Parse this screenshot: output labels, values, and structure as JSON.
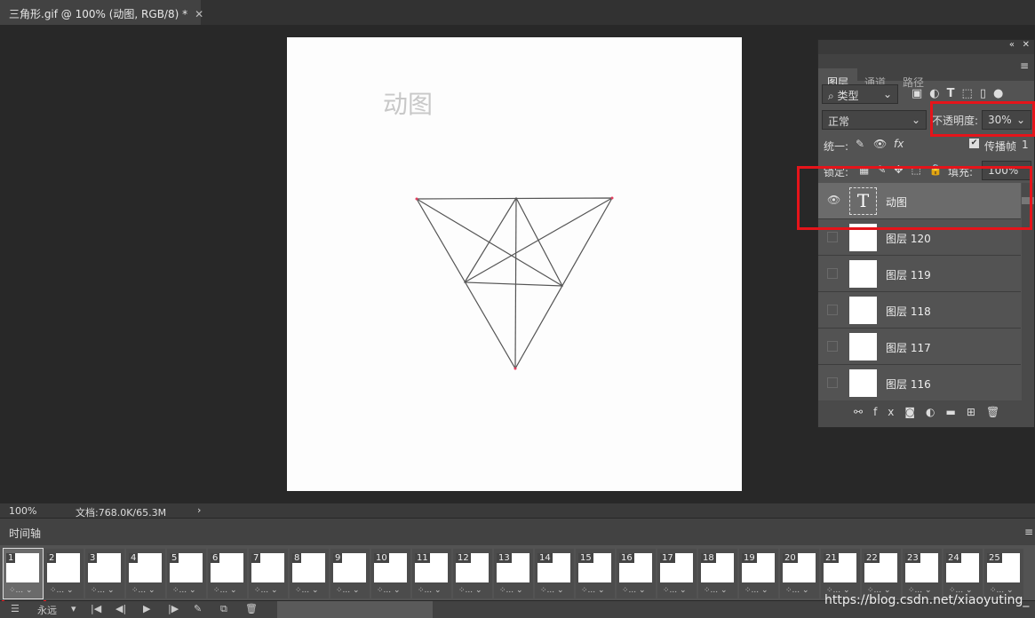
{
  "document": {
    "tab_title": "三角形.gif @ 100% (动图, RGB/8) *",
    "canvas_text": "动图"
  },
  "layers_panel": {
    "tabs": [
      "图层",
      "通道",
      "路径"
    ],
    "filter_kind": "类型",
    "blend_mode": "正常",
    "opacity_label": "不透明度:",
    "opacity_value": "30%",
    "unify_label": "统一:",
    "propagate_label": "传播帧",
    "propagate_value": "1",
    "propagate_checked": true,
    "lock_label": "锁定:",
    "fill_label": "填充:",
    "fill_value": "100%",
    "layers": [
      {
        "name": "动图",
        "type": "text",
        "visible": true,
        "selected": true
      },
      {
        "name": "图层 120",
        "visible": false
      },
      {
        "name": "图层 119",
        "visible": false
      },
      {
        "name": "图层 118",
        "visible": false
      },
      {
        "name": "图层 117",
        "visible": false
      },
      {
        "name": "图层 116",
        "visible": false
      }
    ]
  },
  "status": {
    "zoom": "100%",
    "doc_info": "文档:768.0K/65.3M"
  },
  "timeline": {
    "title": "时间轴",
    "loop": "永远",
    "selected_frame": 1,
    "frames": [
      "1",
      "2",
      "3",
      "4",
      "5",
      "6",
      "7",
      "8",
      "9",
      "10",
      "11",
      "12",
      "13",
      "14",
      "15",
      "16",
      "17",
      "18",
      "19",
      "20",
      "21",
      "22",
      "23",
      "24",
      "25"
    ],
    "delay_label": "..."
  },
  "watermark": "https://blog.csdn.net/xiaoyuting_",
  "colors": {
    "highlight": "#e5141a",
    "panel": "#535353"
  }
}
